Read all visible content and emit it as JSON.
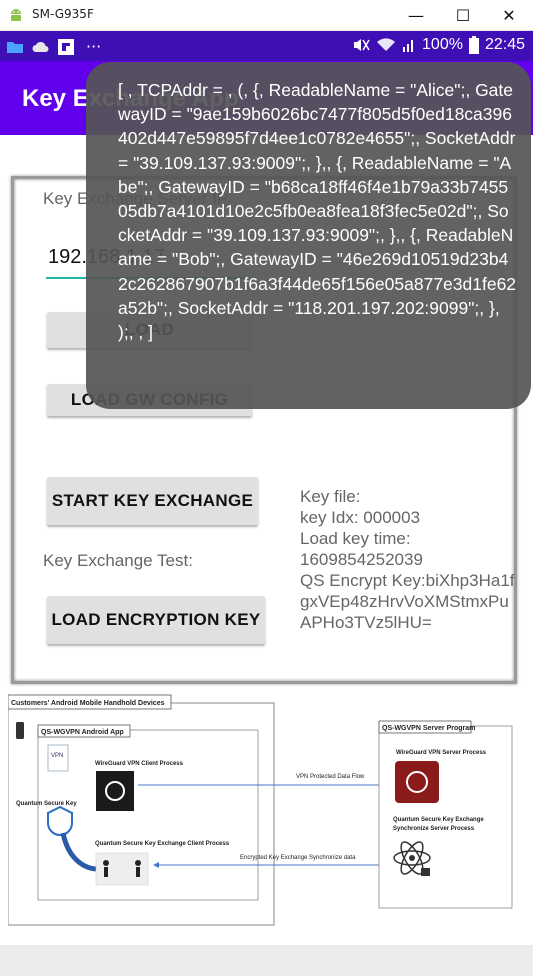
{
  "window": {
    "title": "SM-G935F",
    "minimize": "—",
    "maximize": "☐",
    "close": "✕"
  },
  "statusbar": {
    "battery": "100%",
    "time": "22:45",
    "dots": "···"
  },
  "appbar": {
    "title": "Key Exchange App"
  },
  "form": {
    "ip_label": "Key Exchange Server IP",
    "ip_value": "192.168.1.17",
    "load_button": "LOAD",
    "load_gw_config": "LOAD GW CONFIG",
    "start_key_exchange": "START KEY EXCHANGE",
    "key_exchange_test": "Key Exchange Test:",
    "load_encryption_key": "LOAD ENCRYPTION KEY"
  },
  "info": {
    "line1": "Key file:",
    "line2": "key Idx: 000003",
    "line3": "Load key time:",
    "line4": "1609854252039",
    "line5": "QS Encrypt Key:biXhp3Ha1fgxVEp48zHrvVoXMStmxPuAPHo3TVz5lHU="
  },
  "toast": {
    "text": "[ , TCPAddr = , (, {,    ReadableName = \"Alice\";,    GatewayID = \"9ae159b6026bc7477f805d5f0ed18ca396402d447e59895f7d4ee1c0782e4655\";,    SocketAddr = \"39.109.137.93:9009\";,  },, {,    ReadableName = \"Abe\";,    GatewayID = \"b68ca18ff46f4e1b79a33b745505db7a4101d10e2c5fb0ea8fea18f3fec5e02d\";,    SocketAddr = \"39.109.137.93:9009\";,  },, {,    ReadableName = \"Bob\";,    GatewayID = \"46e269d10519d23b42c262867907b1f6a3f44de65f156e05a877e3d1fe62a52b\";,    SocketAddr = \"118.201.197.202:9099\";,  }, );, , ]"
  },
  "diagram": {
    "customers_title": "Customers' Android Mobile Handhold Devices",
    "android_app": "QS-WGVPN Android App",
    "server_program": "QS-WGVPN Server Program",
    "wg_client": "WireGuard VPN Client Process",
    "wg_server": "WireGuard VPN Server Process",
    "vpn_flow": "VPN Protected Data Flow",
    "qs_key": "Quantum Secure Key",
    "qske_client": "Quantum Secure Key Exchange Client Process",
    "qske_server_1": "Quantum Secure Key Exchange",
    "qske_server_2": "Synchronize Server  Process",
    "enc_sync": "Encrypted Key Exchange Synchronize data",
    "vpn_badge": "VPN"
  },
  "colors": {
    "statusbar": "#3d0fb4",
    "appbar": "#6200ee",
    "accent": "#1fb5a8"
  },
  "icons": [
    "android-icon",
    "folder-icon",
    "cloud-icon",
    "flipboard-icon",
    "mute-icon",
    "wifi-icon",
    "signal-icon",
    "battery-icon"
  ]
}
